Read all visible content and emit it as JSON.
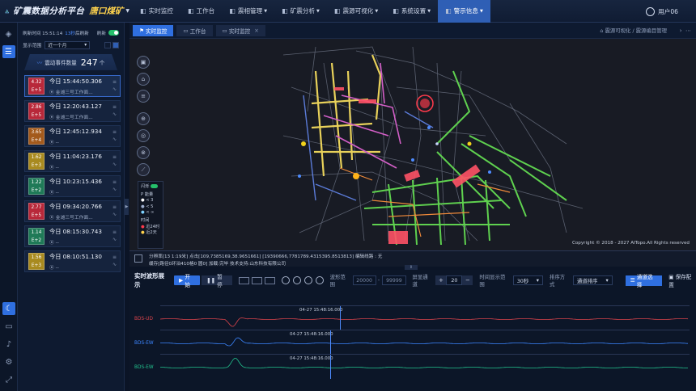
{
  "header": {
    "platform_name": "矿震数据分析平台",
    "mine_name": "唐口煤矿",
    "nav": [
      {
        "label": "实时监控",
        "icon": "monitor-icon",
        "dropdown": false
      },
      {
        "label": "工作台",
        "icon": "desktop-icon",
        "dropdown": false
      },
      {
        "label": "震相管理",
        "icon": "document-icon",
        "dropdown": true
      },
      {
        "label": "矿震分析",
        "icon": "chart-icon",
        "dropdown": true
      },
      {
        "label": "震源可视化",
        "icon": "eye-icon",
        "dropdown": true
      },
      {
        "label": "系统设置",
        "icon": "gear-icon",
        "dropdown": true
      },
      {
        "label": "警示信息",
        "icon": "bell-icon",
        "dropdown": true,
        "active": true
      }
    ],
    "user": "用户06"
  },
  "panel": {
    "refresh_text": "刷新时间 15:51:14",
    "refresh_countdown": "13秒",
    "refresh_after": "后刷新",
    "refresh_toggle_label": "刷新",
    "range_label": "显示范围",
    "range_value": "近一个月",
    "count_label": "震动事件数量",
    "count_value": "247",
    "count_unit": "个",
    "events": [
      {
        "mag": "4.32",
        "exp": "E+5",
        "color": "#b8283a",
        "time": "今日 15:44:50.306",
        "loc": "金滩三号工作面...",
        "selected": true
      },
      {
        "mag": "2.86",
        "exp": "E+5",
        "color": "#b8283a",
        "time": "今日 12:20:43.127",
        "loc": "金滩二号工作面...",
        "selected": false
      },
      {
        "mag": "3.65",
        "exp": "E+4",
        "color": "#a35a1c",
        "time": "今日 12:45:12.934",
        "loc": "--",
        "selected": false
      },
      {
        "mag": "1.62",
        "exp": "E+3",
        "color": "#a88a1f",
        "time": "今日 11:04:23.176",
        "loc": "--",
        "selected": false
      },
      {
        "mag": "1.22",
        "exp": "E+2",
        "color": "#1f7a57",
        "time": "今日 10:23:15.436",
        "loc": "--",
        "selected": false
      },
      {
        "mag": "2.77",
        "exp": "E+5",
        "color": "#b8283a",
        "time": "今日 09:34:20.766",
        "loc": "金滩三号工作面...",
        "selected": false
      },
      {
        "mag": "1.14",
        "exp": "E+2",
        "color": "#1f7a57",
        "time": "今日 08:15:30.743",
        "loc": "--",
        "selected": false
      },
      {
        "mag": "1.56",
        "exp": "E+3",
        "color": "#a88a1f",
        "time": "今日 08:10:51.130",
        "loc": "--",
        "selected": false
      }
    ]
  },
  "tabs": [
    {
      "label": "实时监控",
      "active": true
    },
    {
      "label": "工作台",
      "active": false
    },
    {
      "label": "实时监控",
      "active": false,
      "closable": true
    }
  ],
  "breadcrumb": "震源可视化 / 震源编目管理",
  "map": {
    "legend": {
      "flash_label": "闪烁",
      "energy_title": "P 能量",
      "energy_items": [
        "< 3",
        "< 5",
        "< ∞"
      ],
      "time_title": "时间",
      "time_items": [
        "近24时",
        "近2天"
      ]
    },
    "copyright": "Copyright © 2018 - 2027 AITopo.All Rights reserved"
  },
  "status": {
    "line1": "分辨率[13 1:19米] 点击[109,7385169,38.9651661] [19390666,7781789.4315395.8513813] 编辑线路 : 无",
    "line2": "缓存[路径0环泊410格0 圆0] 加载:完毕 技术支持:山东科技有限公司"
  },
  "wave": {
    "title": "实时波形展示",
    "start": "开始",
    "pause": "暂停",
    "wave_range_label": "波形范围",
    "wave_min": "20000",
    "wave_max": "99999",
    "channel_label": "屏显通道",
    "channel_value": "20",
    "time_range_label": "时间显示范围",
    "time_range_value": "30秒",
    "sort_label": "排序方式",
    "sort_value": "通道排序",
    "channel_select_btn": "通道选择",
    "save_btn": "保存配置",
    "tracks": [
      {
        "name": "BDS-UD",
        "time": "04-27 15:48:16.000",
        "color": "#d9434b"
      },
      {
        "name": "BDS-EW",
        "time": "04-27 15:48:16.000",
        "color": "#3c86ff"
      },
      {
        "name": "BDS-EW",
        "time": "04-27 15:48:16.000",
        "color": "#22c38e"
      }
    ]
  },
  "colors": {
    "accent": "#2f6fe0",
    "gold": "#ffd34d"
  }
}
